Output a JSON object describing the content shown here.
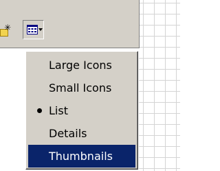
{
  "toolbar": {
    "new_folder_icon": "new-folder-icon",
    "views_icon": "views-grid-icon",
    "views_dropdown_icon": "dropdown-arrow-icon"
  },
  "views_menu": {
    "items": [
      {
        "label": "Large Icons",
        "checked": false,
        "highlighted": false
      },
      {
        "label": "Small Icons",
        "checked": false,
        "highlighted": false
      },
      {
        "label": "List",
        "checked": true,
        "highlighted": false
      },
      {
        "label": "Details",
        "checked": false,
        "highlighted": false
      },
      {
        "label": "Thumbnails",
        "checked": false,
        "highlighted": true
      }
    ]
  },
  "colors": {
    "menu_background": "#d4d0c8",
    "highlight": "#0a246a",
    "highlight_text": "#ffffff"
  }
}
